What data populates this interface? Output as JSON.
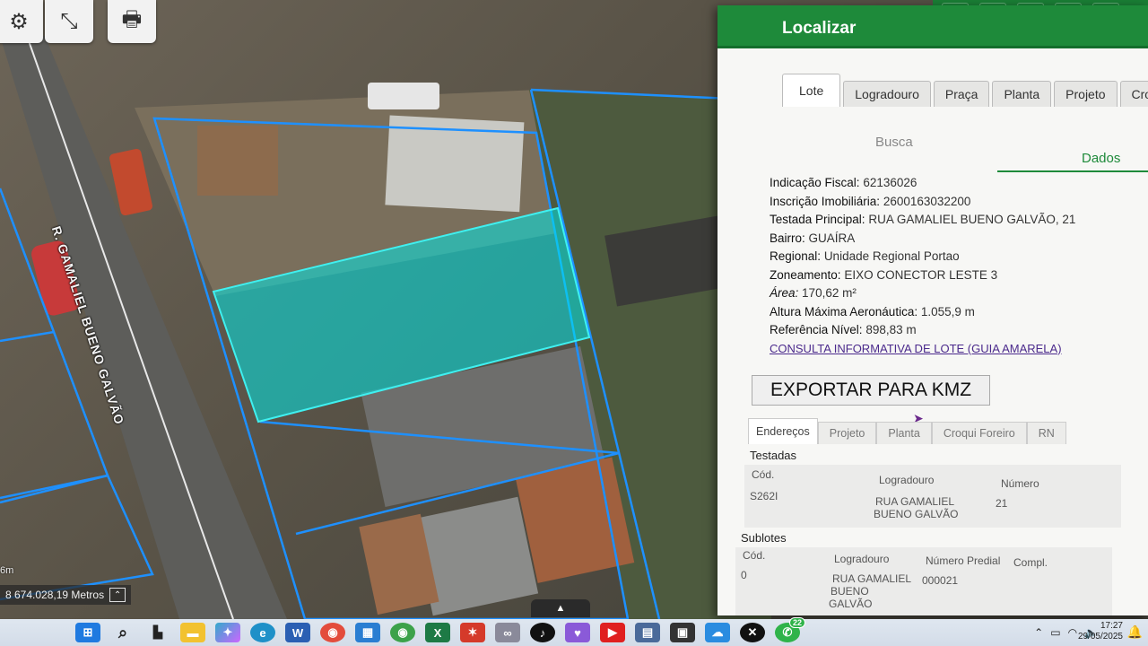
{
  "map": {
    "street_label": "R. GAMALIEL BUENO GALVÃO",
    "scale_text": "8 674.028,19 Metros",
    "scale_unit": "6m",
    "tools": [
      {
        "name": "map-settings-button",
        "icon": "gear-icon"
      },
      {
        "name": "zoom-feature-button",
        "icon": "cursor-zoom-icon"
      },
      {
        "name": "print-button",
        "icon": "printer-icon"
      }
    ]
  },
  "panel": {
    "title": "Localizar",
    "tabs": [
      "Lote",
      "Logradouro",
      "Praça",
      "Planta",
      "Projeto",
      "Croq"
    ],
    "subtabs": {
      "busca": "Busca",
      "dados": "Dados"
    },
    "info": [
      {
        "label": "Indicação Fiscal:",
        "value": "62136026"
      },
      {
        "label": "Inscrição Imobiliária:",
        "value": "2600163032200"
      },
      {
        "label": "Testada Principal:",
        "value": "RUA GAMALIEL BUENO GALVÃO, 21"
      },
      {
        "label": "Bairro:",
        "value": "GUAÍRA"
      },
      {
        "label": "Regional:",
        "value": "Unidade Regional Portao"
      },
      {
        "label": "Zoneamento:",
        "value": "EIXO CONECTOR LESTE 3"
      },
      {
        "label": "Área:",
        "value": "170,62 m²"
      },
      {
        "label": "Altura Máxima Aeronáutica:",
        "value": "1.055,9 m"
      },
      {
        "label": "Referência Nível:",
        "value": "898,83 m"
      }
    ],
    "consulta_link": "CONSULTA INFORMATIVA DE LOTE (GUIA AMARELA)",
    "export_button": "EXPORTAR PARA KMZ",
    "bottom_tabs": [
      "Endereços",
      "Projeto",
      "Planta",
      "Croqui Foreiro",
      "RN"
    ],
    "testadas": {
      "title": "Testadas",
      "headers": {
        "cod": "Cód.",
        "logradouro": "Logradouro",
        "numero": "Número"
      },
      "row": {
        "cod": "S262I",
        "logradouro_1": "RUA GAMALIEL",
        "logradouro_2": "BUENO GALVÃO",
        "numero": "21"
      }
    },
    "sublotes": {
      "title": "Sublotes",
      "headers": {
        "cod": "Cód.",
        "logradouro": "Logradouro",
        "numero": "Número Predial",
        "compl": "Compl."
      },
      "row": {
        "cod": "0",
        "logradouro_1": "RUA GAMALIEL",
        "logradouro_2": "BUENO",
        "logradouro_3": "GALVÃO",
        "numero": "000021"
      }
    }
  },
  "taskbar": {
    "apps": [
      "start-icon",
      "search-icon",
      "task-view-icon",
      "file-explorer-icon",
      "copilot-icon",
      "edge-icon",
      "word-icon",
      "chrome-icon",
      "store-icon",
      "chrome-alt-icon",
      "excel-icon",
      "app-red-icon",
      "app-gray-icon",
      "tiktok-icon",
      "brave-icon",
      "youtube-icon",
      "calculator-icon",
      "app-dark-icon",
      "onedrive-icon",
      "x-icon",
      "whatsapp-icon"
    ],
    "whatsapp_badge": "22",
    "time": "17:27",
    "date": "29/05/2025"
  },
  "colors": {
    "header_green": "#1e8a3a",
    "lot_highlight": "#00e5e5",
    "parcel_line": "#1e90ff"
  }
}
